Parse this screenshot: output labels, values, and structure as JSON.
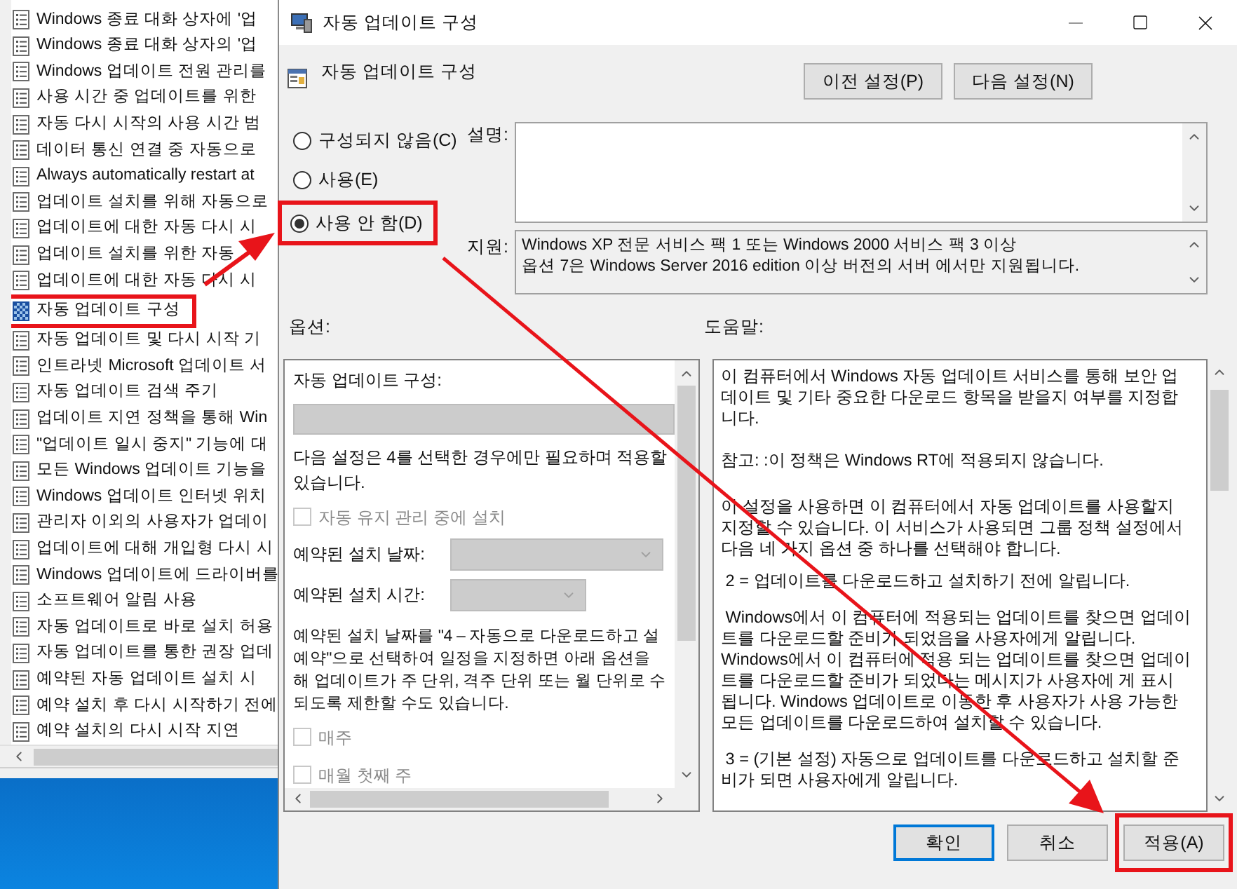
{
  "policy_list": {
    "items": [
      {
        "label": "Windows 종료 대화 상자에 '업",
        "selected": false,
        "highlighted": false
      },
      {
        "label": "Windows 종료 대화 상자의 '업",
        "selected": false,
        "highlighted": false
      },
      {
        "label": "Windows 업데이트 전원 관리를",
        "selected": false,
        "highlighted": false
      },
      {
        "label": "사용 시간 중 업데이트를 위한",
        "selected": false,
        "highlighted": false
      },
      {
        "label": "자동 다시 시작의 사용 시간 범",
        "selected": false,
        "highlighted": false
      },
      {
        "label": "데이터 통신 연결 중 자동으로",
        "selected": false,
        "highlighted": false
      },
      {
        "label": "Always automatically restart at",
        "selected": false,
        "highlighted": false
      },
      {
        "label": "업데이트 설치를 위해 자동으로",
        "selected": false,
        "highlighted": false
      },
      {
        "label": "업데이트에 대한 자동 다시 시",
        "selected": false,
        "highlighted": false
      },
      {
        "label": "업데이트 설치를 위한 자동",
        "selected": false,
        "highlighted": false
      },
      {
        "label": "업데이트에 대한 자동 다시 시",
        "selected": false,
        "highlighted": false
      },
      {
        "label": "자동 업데이트 구성",
        "selected": true,
        "highlighted": true
      },
      {
        "label": "자동 업데이트 및 다시 시작 기",
        "selected": false,
        "highlighted": false
      },
      {
        "label": "인트라넷 Microsoft 업데이트 서",
        "selected": false,
        "highlighted": false
      },
      {
        "label": "자동 업데이트 검색 주기",
        "selected": false,
        "highlighted": false
      },
      {
        "label": "업데이트 지연 정책을 통해 Win",
        "selected": false,
        "highlighted": false
      },
      {
        "label": "\"업데이트 일시 중지\" 기능에 대",
        "selected": false,
        "highlighted": false
      },
      {
        "label": "모든 Windows 업데이트 기능을",
        "selected": false,
        "highlighted": false
      },
      {
        "label": "Windows 업데이트 인터넷 위치",
        "selected": false,
        "highlighted": false
      },
      {
        "label": "관리자 이외의 사용자가 업데이",
        "selected": false,
        "highlighted": false
      },
      {
        "label": "업데이트에 대해 개입형 다시 시",
        "selected": false,
        "highlighted": false
      },
      {
        "label": "Windows 업데이트에 드라이버를",
        "selected": false,
        "highlighted": false
      },
      {
        "label": "소프트웨어 알림 사용",
        "selected": false,
        "highlighted": false
      },
      {
        "label": "자동 업데이트로 바로 설치 허용",
        "selected": false,
        "highlighted": false
      },
      {
        "label": "자동 업데이트를 통한 권장 업데",
        "selected": false,
        "highlighted": false
      },
      {
        "label": "예약된 자동 업데이트 설치 시",
        "selected": false,
        "highlighted": false
      },
      {
        "label": "예약 설치 후 다시 시작하기 전에",
        "selected": false,
        "highlighted": false
      },
      {
        "label": "예약 설치의 다시 시작 지연",
        "selected": false,
        "highlighted": false
      }
    ]
  },
  "dialog": {
    "title": "자동 업데이트 구성",
    "header": "자동 업데이트 구성",
    "nav_buttons": [
      "이전 설정(P)",
      "다음 설정(N)"
    ],
    "states": [
      {
        "label": "구성되지 않음(C)",
        "selected": false,
        "highlighted": false
      },
      {
        "label": "사용(E)",
        "selected": false,
        "highlighted": false
      },
      {
        "label": "사용 안 함(D)",
        "selected": true,
        "highlighted": true
      }
    ],
    "comment_label": "설명:",
    "supported_label": "지원:",
    "supported_text": "Windows XP 전문 서비스 팩 1 또는 Windows 2000 서비스 팩 3 이상\n옵션 7은 Windows Server 2016 edition 이상 버전의 서버 에서만 지원됩니다.",
    "options_label": "옵션:",
    "help_label": "도움말:",
    "options": [
      {
        "kind": "text",
        "text": "자동 업데이트 구성:"
      },
      {
        "kind": "select",
        "disabled": true
      },
      {
        "kind": "text",
        "text": "다음 설정은 4를 선택한 경우에만 필요하며 적용할 있습니다."
      },
      {
        "kind": "checkbox",
        "label": "자동 유지 관리 중에 설치",
        "checked": false,
        "disabled": true
      },
      {
        "kind": "dropdown",
        "label": "예약된 설치 날짜:",
        "disabled": true
      },
      {
        "kind": "dropdown",
        "label": "예약된 설치 시간:",
        "disabled": true
      },
      {
        "kind": "paragraph",
        "text": "예약된 설치 날짜를 \"4 – 자동으로 다운로드하고 설\n예약\"으로 선택하여 일정을 지정하면 아래 옵션을\n해 업데이트가 주 단위, 격주 단위 또는 월 단위로 수\n되도록 제한할 수도 있습니다."
      },
      {
        "kind": "checkbox",
        "label": "매주",
        "checked": false,
        "disabled": true
      },
      {
        "kind": "checkbox",
        "label": "매월 첫째 주",
        "checked": false,
        "disabled": true
      }
    ],
    "help": [
      "이 컴퓨터에서 Windows 자동 업데이트 서비스를 통해 보안 업데이트 및 기타 중요한 다운로드 항목을 받을지 여부를 지정합니다.",
      "참고: :이 정책은 Windows RT에 적용되지 않습니다.",
      "이 설정을 사용하면 이 컴퓨터에서 자동 업데이트를 사용할지 지정할 수 있습니다. 이 서비스가 사용되면 그룹 정책 설정에서 다음 네 가지 옵션 중 하나를 선택해야 합니다.",
      " 2 = 업데이트를 다운로드하고 설치하기 전에 알립니다.",
      " Windows에서 이 컴퓨터에 적용되는 업데이트를 찾으면 업데이트를 다운로드할 준비가 되었음을 사용자에게 알립니다.\nWindows에서 이 컴퓨터에 적용 되는 업데이트를 찾으면 업데이트를 다운로드할 준비가 되었다는 메시지가 사용자에 게 표시 됩니다. Windows 업데이트로 이동한 후 사용자가 사용 가능한 모든 업데이트를 다운로드하여 설치할 수 있습니다.",
      " 3 = (기본 설정) 자동으로 업데이트를 다운로드하고 설치할 준비가 되면 사용자에게 알립니다."
    ],
    "buttons": [
      {
        "label": "확인",
        "kind": "default",
        "highlighted": false
      },
      {
        "label": "취소",
        "kind": "normal",
        "highlighted": false
      },
      {
        "label": "적용(A)",
        "kind": "normal",
        "highlighted": true
      }
    ]
  }
}
